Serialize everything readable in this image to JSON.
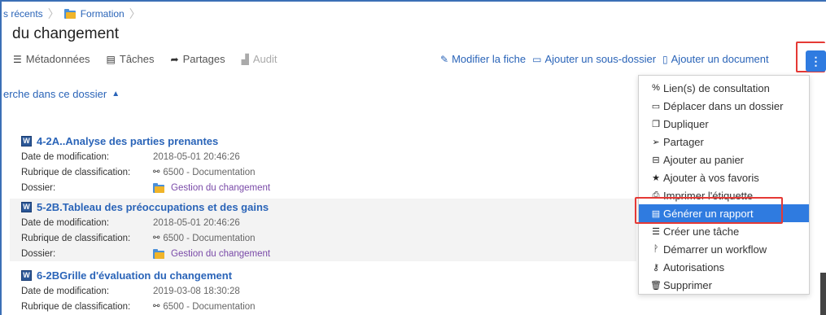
{
  "breadcrumb": {
    "items": [
      "s récents",
      "Formation"
    ]
  },
  "page": {
    "title": "du changement"
  },
  "tabs": [
    {
      "label": "Métadonnées",
      "icon": "list-icon",
      "disabled": false
    },
    {
      "label": "Tâches",
      "icon": "tasks-icon",
      "disabled": false
    },
    {
      "label": "Partages",
      "icon": "share-arrow-icon",
      "disabled": false
    },
    {
      "label": "Audit",
      "icon": "chart-icon",
      "disabled": true
    }
  ],
  "actions": [
    {
      "label": "Modifier la fiche",
      "icon": "edit-icon"
    },
    {
      "label": "Ajouter un sous-dossier",
      "icon": "folder-outline-icon"
    },
    {
      "label": "Ajouter un document",
      "icon": "file-outline-icon"
    }
  ],
  "kebab": {
    "label": "⋮"
  },
  "search_toggle": {
    "label": "erche dans ce dossier",
    "chevron": "^"
  },
  "documents": [
    {
      "title": "4-2A..Analyse des parties prenantes",
      "labels": [
        "Date de modification:",
        "Rubrique de classification:",
        "Dossier:"
      ],
      "date": "2018-05-01 20:46:26",
      "rubrique": "6500 - Documentation",
      "dossier": "Gestion du changement"
    },
    {
      "title": "5-2B.Tableau des préoccupations et des gains",
      "labels": [
        "Date de modification:",
        "Rubrique de classification:",
        "Dossier:"
      ],
      "date": "2018-05-01 20:46:26",
      "rubrique": "6500 - Documentation",
      "dossier": "Gestion du changement"
    },
    {
      "title": "6-2BGrille d'évaluation du changement",
      "labels": [
        "Date de modification:",
        "Rubrique de classification:"
      ],
      "date": "2019-03-08 18:30:28",
      "rubrique": "6500 - Documentation"
    }
  ],
  "menu": [
    {
      "label": "Lien(s) de consultation",
      "icon": "link-icon"
    },
    {
      "label": "Déplacer dans un dossier",
      "icon": "folder-outline-icon"
    },
    {
      "label": "Dupliquer",
      "icon": "copy-icon"
    },
    {
      "label": "Partager",
      "icon": "paper-plane-icon"
    },
    {
      "label": "Ajouter au panier",
      "icon": "basket-icon"
    },
    {
      "label": "Ajouter à vos favoris",
      "icon": "star-icon"
    },
    {
      "label": "Imprimer l'étiquette",
      "icon": "print-icon"
    },
    {
      "label": "Générer un rapport",
      "icon": "report-icon",
      "active": true
    },
    {
      "label": "Créer une tâche",
      "icon": "tasks-icon"
    },
    {
      "label": "Démarrer un workflow",
      "icon": "workflow-icon"
    },
    {
      "label": "Autorisations",
      "icon": "key-icon"
    },
    {
      "label": "Supprimer",
      "icon": "trash-icon"
    }
  ],
  "colors": {
    "link": "#2a64b8",
    "accent": "#2f7be0",
    "highlight": "#e53935",
    "folder_link": "#7a4aa8"
  }
}
